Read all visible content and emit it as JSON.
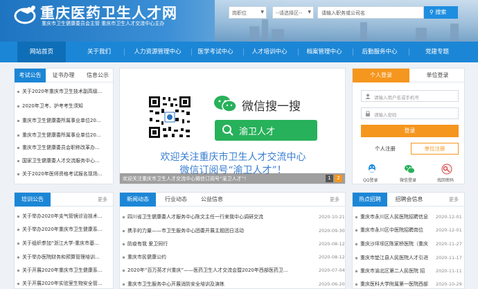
{
  "header": {
    "title": "重庆医药卫生人才网",
    "subtitle": "重庆市卫生健康委员会主管 重庆市卫生人才交流中心主办",
    "select_type": "岗职位",
    "select_area": "--请选择区--",
    "search_placeholder": "请输入职务或公司名",
    "search_button": "搜索"
  },
  "nav": [
    "网站首页",
    "关于我们",
    "人力资源管理中心",
    "医学考试中心",
    "人才培训中心",
    "档案管理中心",
    "后勤服务中心",
    "党建专题"
  ],
  "notice_panel": {
    "tabs": [
      "考试公告",
      "证书办理",
      "信息公示"
    ],
    "items": [
      "关于2020年重庆市卫生技术副高级...",
      "2020年卫考、护考考生须知",
      "重庆市卫生健康委所属事业单位20...",
      "重庆市卫生健康委所属事业单位20...",
      "重庆市卫生健康委员会职称改革办...",
      "国家卫生健康委人才交流服务中心...",
      "关于2020年医师资格考试报名现场..."
    ]
  },
  "carousel": {
    "wechat_search": "微信搜一搜",
    "wechat_keyword": "渝卫人才",
    "line1": "欢迎关注重庆市卫生人才交流中心",
    "line2": "微信订阅号“渝卫人才”！",
    "caption": "欢迎关注重庆市卫生人才交流中心微信订阅号“渝卫人才”！",
    "pages": [
      "1",
      "2"
    ]
  },
  "login": {
    "tabs": [
      "个人登录",
      "单位登录"
    ],
    "user_placeholder": "请输入用户名或手机号",
    "pass_placeholder": "请输入密码",
    "login_button": "登录",
    "register_button": "个人注册",
    "unit_register_button": "单位注册",
    "social": [
      "QQ登录",
      "微信登录",
      "找回密码"
    ]
  },
  "training_panel": {
    "tabs": [
      "培训公告"
    ],
    "more": "更多",
    "items": [
      "关于举办2020年支气管镜诊治技术...",
      "关于举办2020年重庆市卫生健康系...",
      "关于组织参加“浙江大学-重庆市基...",
      "关于举办医院财务和预算管理培训...",
      "关于开展2020年重庆市卫生健康系...",
      "关于开展2020年实验室生物安全管..."
    ]
  },
  "news_panel": {
    "tabs": [
      "新闻动态",
      "行业动态",
      "公益信息"
    ],
    "more": "更多",
    "items": [
      {
        "title": "四川省卫生健康委人才服务中心陈文主任一行来我中心调研交流",
        "date": "2020-10-21"
      },
      {
        "title": "携手的力量——市卫生服务中心团委开展主题团日活动",
        "date": "2020-09-30"
      },
      {
        "title": "防疫有我 爱卫同行",
        "date": "2020-08-12"
      },
      {
        "title": "重庆市民健康公约",
        "date": "2020-08-12"
      },
      {
        "title": "2020年“百万英才兴重庆”——医药卫生人才交流会暨2020年西部医药卫...",
        "date": "2020-07-04"
      },
      {
        "title": "重庆市卫生服务中心开展消防安全培训及演练",
        "date": "2020-06-20"
      }
    ]
  },
  "jobs_panel": {
    "tabs": [
      "热点招聘",
      "招聘会信息"
    ],
    "more": "更多",
    "items": [
      {
        "title": "重庆市永川区人民医院招聘信息",
        "date": "2020-12-01"
      },
      {
        "title": "重庆市永川区中医院招聘岗位",
        "date": "2020-12-01"
      },
      {
        "title": "重庆沙坪坝区陈家桥医院（重庆",
        "date": "2020-11-27"
      },
      {
        "title": "重庆市垫江县人民医院人才引进",
        "date": "2020-11-17"
      },
      {
        "title": "重庆市渝北区第二人民医院 招",
        "date": "2020-11-11"
      },
      {
        "title": "重庆医科大学附属第一医院西部",
        "date": "2020-10-29"
      }
    ]
  },
  "colors": {
    "brand": "#1c86d6",
    "accent": "#f5961e",
    "wechat": "#27b15a"
  }
}
